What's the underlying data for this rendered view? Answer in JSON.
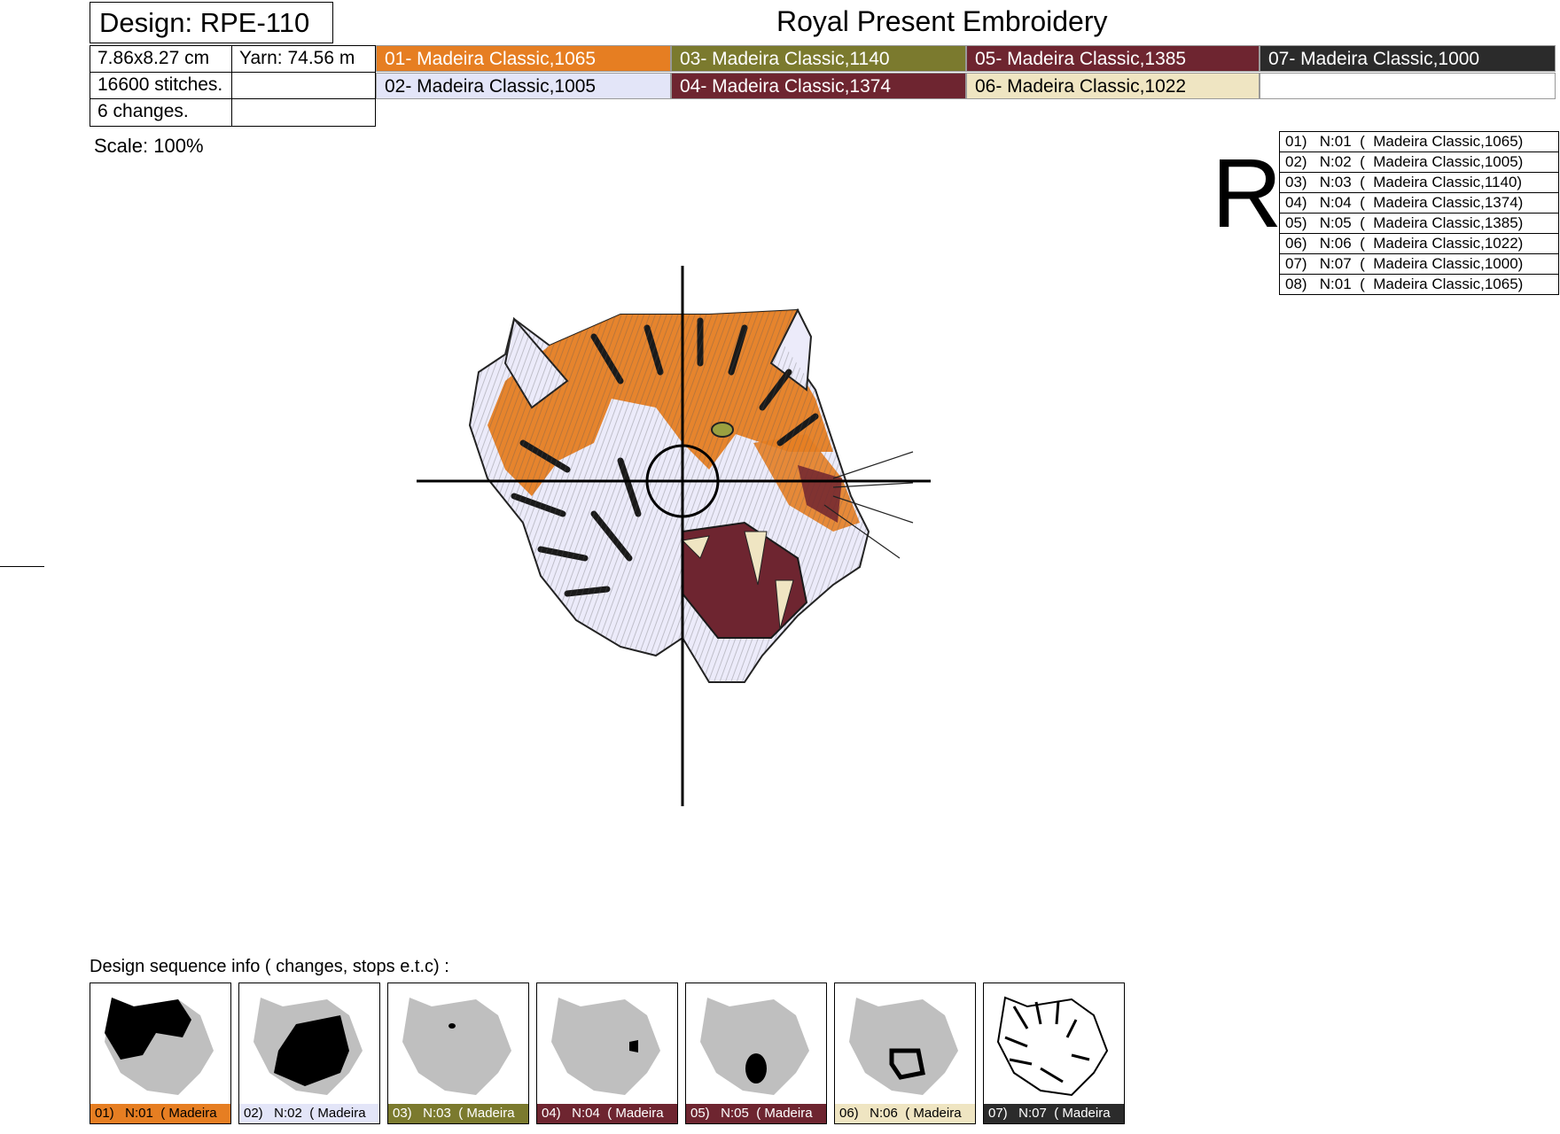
{
  "header": {
    "design_label": "Design: RPE-110",
    "company": "Royal Present Embroidery"
  },
  "info": {
    "size": "7.86x8.27 cm",
    "yarn": "Yarn: 74.56 m",
    "stitches": "16600 stitches.",
    "changes": "6 changes.",
    "scale": "Scale: 100%"
  },
  "threads": [
    {
      "label": "01- Madeira Classic,1065",
      "bg": "#e67e22",
      "fg": "#ffffff"
    },
    {
      "label": "02- Madeira Classic,1005",
      "bg": "#e3e5f8",
      "fg": "#000000"
    },
    {
      "label": "03- Madeira Classic,1140",
      "bg": "#7b7a2e",
      "fg": "#ffffff"
    },
    {
      "label": "04- Madeira Classic,1374",
      "bg": "#6e2530",
      "fg": "#ffffff"
    },
    {
      "label": "05- Madeira Classic,1385",
      "bg": "#6e2530",
      "fg": "#ffffff"
    },
    {
      "label": "06- Madeira Classic,1022",
      "bg": "#efe5c2",
      "fg": "#000000"
    },
    {
      "label": "07- Madeira Classic,1000",
      "bg": "#2b2b2b",
      "fg": "#ffffff"
    }
  ],
  "orientation_letter": "R",
  "sequence_table": [
    "01)   N:01  (  Madeira Classic,1065)",
    "02)   N:02  (  Madeira Classic,1005)",
    "03)   N:03  (  Madeira Classic,1140)",
    "04)   N:04  (  Madeira Classic,1374)",
    "05)   N:05  (  Madeira Classic,1385)",
    "06)   N:06  (  Madeira Classic,1022)",
    "07)   N:07  (  Madeira Classic,1000)",
    "08)   N:01  (  Madeira Classic,1065)"
  ],
  "sequence_info_title": "Design sequence info   ( changes, stops e.t.c)   :",
  "thumbnails": [
    {
      "label": "01)   N:01  ( Madeira",
      "bg": "#e67e22",
      "fg": "#000000"
    },
    {
      "label": "02)   N:02  ( Madeira",
      "bg": "#e3e5f8",
      "fg": "#000000"
    },
    {
      "label": "03)   N:03  ( Madeira",
      "bg": "#7b7a2e",
      "fg": "#ffffff"
    },
    {
      "label": "04)   N:04  ( Madeira",
      "bg": "#6e2530",
      "fg": "#ffffff"
    },
    {
      "label": "05)   N:05  ( Madeira",
      "bg": "#6e2530",
      "fg": "#ffffff"
    },
    {
      "label": "06)   N:06  ( Madeira",
      "bg": "#efe5c2",
      "fg": "#000000"
    },
    {
      "label": "07)   N:07  ( Madeira",
      "bg": "#2b2b2b",
      "fg": "#ffffff"
    }
  ]
}
